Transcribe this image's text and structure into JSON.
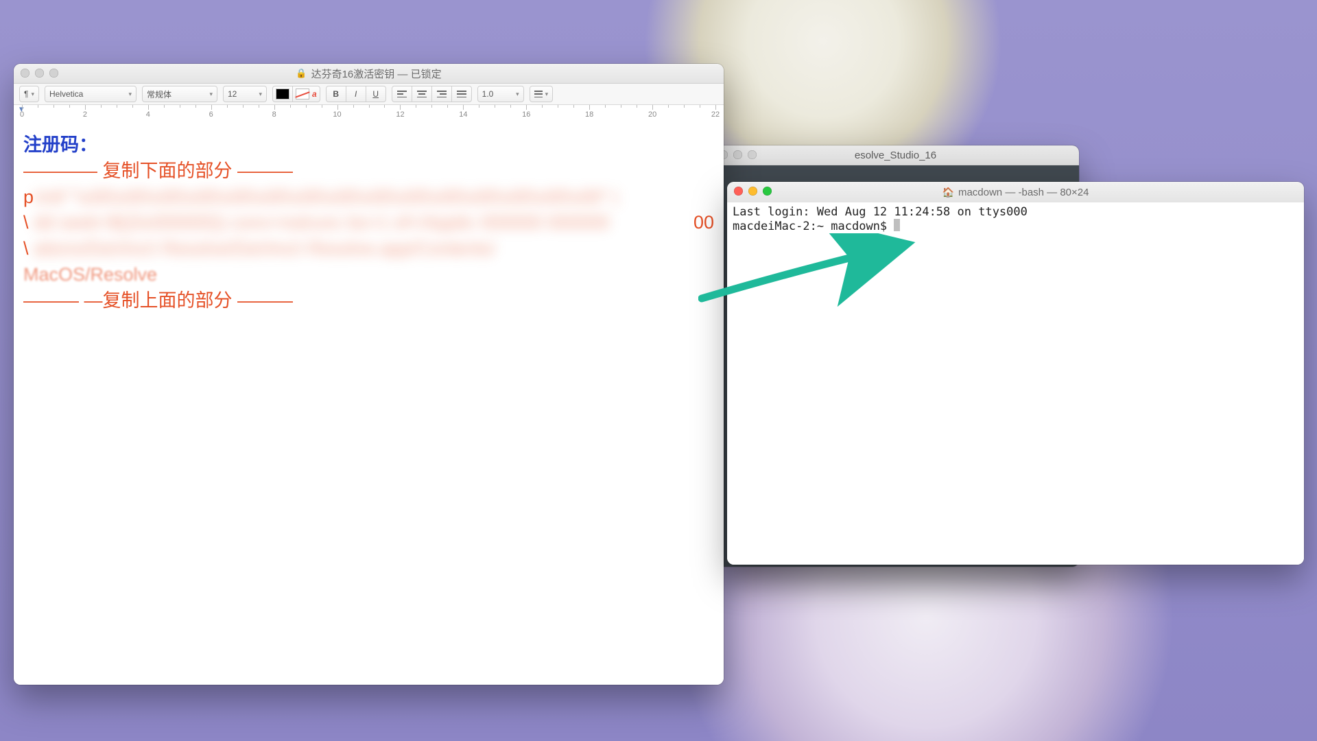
{
  "editor": {
    "title": "达芬奇16激活密钥 — 已锁定",
    "toolbar": {
      "paragraph_menu": "¶",
      "font": "Helvetica",
      "style": "常规体",
      "size": "12",
      "bold": "B",
      "italic": "I",
      "underline": "U",
      "spacing": "1.0",
      "strike_a": "a"
    },
    "ruler_marks": [
      "0",
      "2",
      "4",
      "6",
      "8",
      "10",
      "12",
      "14",
      "16",
      "18",
      "20",
      "22"
    ],
    "content": {
      "heading": "注册码：",
      "top_marker": "———— 复制下面的部分 ———",
      "body_start": "p",
      "body_mid2": "\\",
      "body_mid2_right": "00",
      "body_mid3": "\\",
      "body_tail": "MacOS/Resolve",
      "bottom_marker": "——— —复制上面的部分 ———"
    }
  },
  "bgwin": {
    "title": "esolve_Studio_16"
  },
  "terminal": {
    "title": "macdown — -bash — 80×24",
    "home_icon": "🏠",
    "line1": "Last login: Wed Aug 12 11:24:58 on ttys000",
    "prompt": "macdeiMac-2:~ macdown$ "
  }
}
